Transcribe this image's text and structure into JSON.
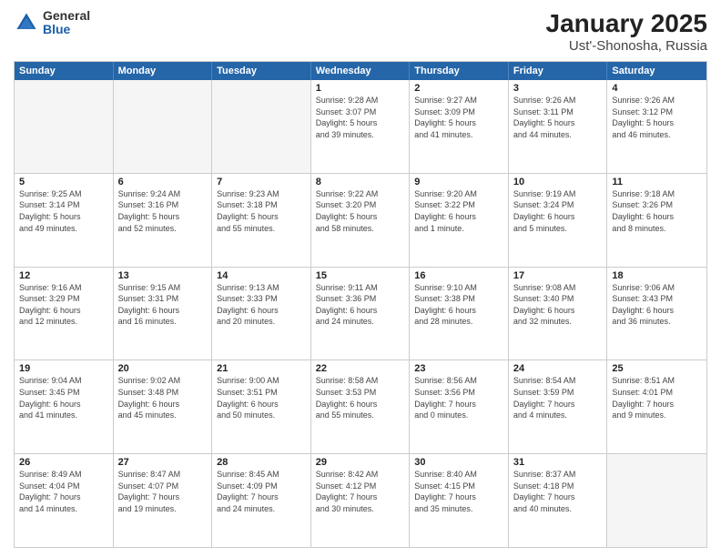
{
  "logo": {
    "general": "General",
    "blue": "Blue"
  },
  "title": "January 2025",
  "subtitle": "Ust'-Shonosha, Russia",
  "weekdays": [
    "Sunday",
    "Monday",
    "Tuesday",
    "Wednesday",
    "Thursday",
    "Friday",
    "Saturday"
  ],
  "rows": [
    [
      {
        "day": "",
        "info": ""
      },
      {
        "day": "",
        "info": ""
      },
      {
        "day": "",
        "info": ""
      },
      {
        "day": "1",
        "info": "Sunrise: 9:28 AM\nSunset: 3:07 PM\nDaylight: 5 hours\nand 39 minutes."
      },
      {
        "day": "2",
        "info": "Sunrise: 9:27 AM\nSunset: 3:09 PM\nDaylight: 5 hours\nand 41 minutes."
      },
      {
        "day": "3",
        "info": "Sunrise: 9:26 AM\nSunset: 3:11 PM\nDaylight: 5 hours\nand 44 minutes."
      },
      {
        "day": "4",
        "info": "Sunrise: 9:26 AM\nSunset: 3:12 PM\nDaylight: 5 hours\nand 46 minutes."
      }
    ],
    [
      {
        "day": "5",
        "info": "Sunrise: 9:25 AM\nSunset: 3:14 PM\nDaylight: 5 hours\nand 49 minutes."
      },
      {
        "day": "6",
        "info": "Sunrise: 9:24 AM\nSunset: 3:16 PM\nDaylight: 5 hours\nand 52 minutes."
      },
      {
        "day": "7",
        "info": "Sunrise: 9:23 AM\nSunset: 3:18 PM\nDaylight: 5 hours\nand 55 minutes."
      },
      {
        "day": "8",
        "info": "Sunrise: 9:22 AM\nSunset: 3:20 PM\nDaylight: 5 hours\nand 58 minutes."
      },
      {
        "day": "9",
        "info": "Sunrise: 9:20 AM\nSunset: 3:22 PM\nDaylight: 6 hours\nand 1 minute."
      },
      {
        "day": "10",
        "info": "Sunrise: 9:19 AM\nSunset: 3:24 PM\nDaylight: 6 hours\nand 5 minutes."
      },
      {
        "day": "11",
        "info": "Sunrise: 9:18 AM\nSunset: 3:26 PM\nDaylight: 6 hours\nand 8 minutes."
      }
    ],
    [
      {
        "day": "12",
        "info": "Sunrise: 9:16 AM\nSunset: 3:29 PM\nDaylight: 6 hours\nand 12 minutes."
      },
      {
        "day": "13",
        "info": "Sunrise: 9:15 AM\nSunset: 3:31 PM\nDaylight: 6 hours\nand 16 minutes."
      },
      {
        "day": "14",
        "info": "Sunrise: 9:13 AM\nSunset: 3:33 PM\nDaylight: 6 hours\nand 20 minutes."
      },
      {
        "day": "15",
        "info": "Sunrise: 9:11 AM\nSunset: 3:36 PM\nDaylight: 6 hours\nand 24 minutes."
      },
      {
        "day": "16",
        "info": "Sunrise: 9:10 AM\nSunset: 3:38 PM\nDaylight: 6 hours\nand 28 minutes."
      },
      {
        "day": "17",
        "info": "Sunrise: 9:08 AM\nSunset: 3:40 PM\nDaylight: 6 hours\nand 32 minutes."
      },
      {
        "day": "18",
        "info": "Sunrise: 9:06 AM\nSunset: 3:43 PM\nDaylight: 6 hours\nand 36 minutes."
      }
    ],
    [
      {
        "day": "19",
        "info": "Sunrise: 9:04 AM\nSunset: 3:45 PM\nDaylight: 6 hours\nand 41 minutes."
      },
      {
        "day": "20",
        "info": "Sunrise: 9:02 AM\nSunset: 3:48 PM\nDaylight: 6 hours\nand 45 minutes."
      },
      {
        "day": "21",
        "info": "Sunrise: 9:00 AM\nSunset: 3:51 PM\nDaylight: 6 hours\nand 50 minutes."
      },
      {
        "day": "22",
        "info": "Sunrise: 8:58 AM\nSunset: 3:53 PM\nDaylight: 6 hours\nand 55 minutes."
      },
      {
        "day": "23",
        "info": "Sunrise: 8:56 AM\nSunset: 3:56 PM\nDaylight: 7 hours\nand 0 minutes."
      },
      {
        "day": "24",
        "info": "Sunrise: 8:54 AM\nSunset: 3:59 PM\nDaylight: 7 hours\nand 4 minutes."
      },
      {
        "day": "25",
        "info": "Sunrise: 8:51 AM\nSunset: 4:01 PM\nDaylight: 7 hours\nand 9 minutes."
      }
    ],
    [
      {
        "day": "26",
        "info": "Sunrise: 8:49 AM\nSunset: 4:04 PM\nDaylight: 7 hours\nand 14 minutes."
      },
      {
        "day": "27",
        "info": "Sunrise: 8:47 AM\nSunset: 4:07 PM\nDaylight: 7 hours\nand 19 minutes."
      },
      {
        "day": "28",
        "info": "Sunrise: 8:45 AM\nSunset: 4:09 PM\nDaylight: 7 hours\nand 24 minutes."
      },
      {
        "day": "29",
        "info": "Sunrise: 8:42 AM\nSunset: 4:12 PM\nDaylight: 7 hours\nand 30 minutes."
      },
      {
        "day": "30",
        "info": "Sunrise: 8:40 AM\nSunset: 4:15 PM\nDaylight: 7 hours\nand 35 minutes."
      },
      {
        "day": "31",
        "info": "Sunrise: 8:37 AM\nSunset: 4:18 PM\nDaylight: 7 hours\nand 40 minutes."
      },
      {
        "day": "",
        "info": ""
      }
    ]
  ]
}
